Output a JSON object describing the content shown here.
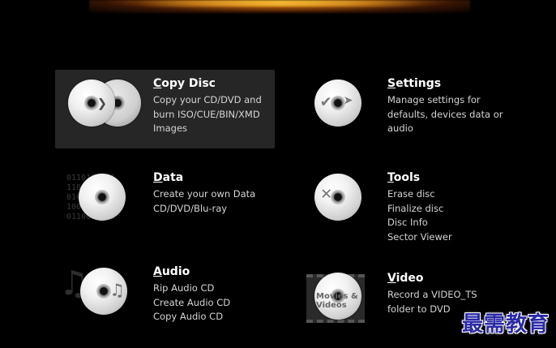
{
  "items": {
    "copy": {
      "title_mnemonic": "C",
      "title_rest": "opy Disc",
      "lines": [
        "Copy your CD/DVD and",
        "burn ISO/CUE/BIN/XMD",
        "Images"
      ]
    },
    "settings": {
      "title_mnemonic": "S",
      "title_rest": "ettings",
      "lines": [
        "Manage settings for",
        "defaults, devices data or",
        "audio"
      ]
    },
    "data": {
      "title_mnemonic": "D",
      "title_rest": "ata",
      "lines": [
        "Create your own Data",
        "CD/DVD/Blu-ray"
      ],
      "deco": [
        "0110100101",
        "1101001010",
        "0101101001",
        "1001011010",
        "0110010110"
      ]
    },
    "tools": {
      "title_mnemonic": "T",
      "title_rest": "ools",
      "lines": [
        "Erase disc",
        "Finalize disc",
        "Disc Info",
        "Sector Viewer"
      ]
    },
    "audio": {
      "title_mnemonic": "A",
      "title_rest": "udio",
      "lines": [
        "Rip Audio CD",
        "Create Audio CD",
        "Copy Audio CD"
      ]
    },
    "video": {
      "title_mnemonic": "V",
      "title_rest": "ideo",
      "lines": [
        "Record a VIDEO_TS",
        "folder to DVD"
      ],
      "deco_text": "Movies & Videos"
    }
  },
  "watermark": "最需教育",
  "colors": {
    "background": "#000000",
    "highlight": "#262626",
    "title": "#ffffff",
    "description": "#d4d4d4",
    "header_glow": "#f1a51a"
  }
}
